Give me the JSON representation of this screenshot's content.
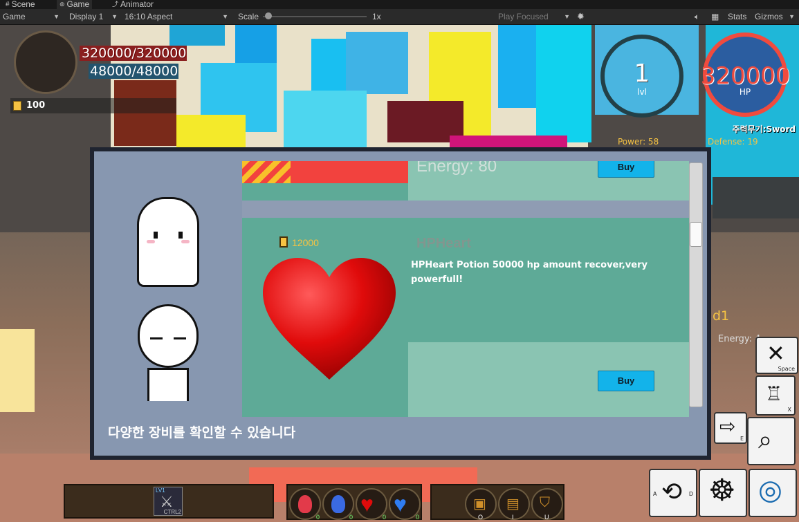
{
  "editor": {
    "tabs": [
      {
        "label": "Scene",
        "icon": "grid-icon"
      },
      {
        "label": "Game",
        "icon": "gamepad-icon"
      },
      {
        "label": "Animator",
        "icon": "animator-icon"
      }
    ],
    "toolbar": {
      "view": "Game",
      "display": "Display 1",
      "aspect": "16:10 Aspect",
      "scale_label": "Scale",
      "scale_value": "1x",
      "scale_level": 0.02,
      "play_mode": "Play Focused",
      "stats": "Stats",
      "gizmos": "Gizmos"
    }
  },
  "hud": {
    "hp_text": "320000/320000",
    "mp_text": "48000/48000",
    "gold": "100",
    "level_value": "1",
    "level_label": "lvl",
    "hp_value": "320000",
    "hp_label": "HP",
    "weapon": "주력무기:Sword",
    "power": "Power: 58",
    "defense": "Defense: 19",
    "side_name": "d1",
    "side_energy": "Energy: 4"
  },
  "shop": {
    "items": [
      {
        "energy": "Energy: 80",
        "buy": "Buy"
      },
      {
        "price": "12000",
        "name": "HPHeart",
        "description": "HPHeart Potion 50000 hp amount recover,very powerfull!",
        "buy": "Buy"
      }
    ],
    "caption": "다양한 장비를 확인할 수 있습니다"
  },
  "hotbar": {
    "weapon_level": "LV1",
    "weapon_key": "CTRL2",
    "potion_counts": [
      "0",
      "0",
      "0",
      "0"
    ],
    "menu_keys": [
      "O",
      "I",
      "U"
    ]
  },
  "controls": {
    "space": "Space",
    "x": "X",
    "e": "E",
    "a": "A",
    "d": "D"
  },
  "colors": {
    "hp_red": "#f04b3e",
    "shop_green": "#5eaa97",
    "buy_blue": "#13b3ea",
    "gold": "#f6c343"
  }
}
